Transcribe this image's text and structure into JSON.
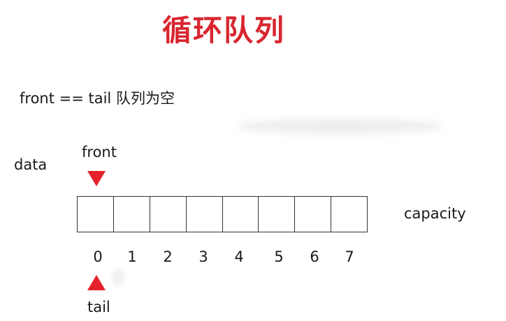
{
  "title": "循环队列",
  "subtitle": "front == tail 队列为空",
  "labels": {
    "data": "data",
    "front": "front",
    "capacity": "capacity",
    "tail": "tail"
  },
  "queue": {
    "cells": [
      "",
      "",
      "",
      "",
      "",
      "",
      "",
      ""
    ],
    "indices": [
      "0",
      "1",
      "2",
      "3",
      "4",
      "5",
      "6",
      "7"
    ],
    "front_index": 0,
    "tail_index": 0
  },
  "colors": {
    "title": "#d8262f",
    "pointer": "#e5222c"
  }
}
